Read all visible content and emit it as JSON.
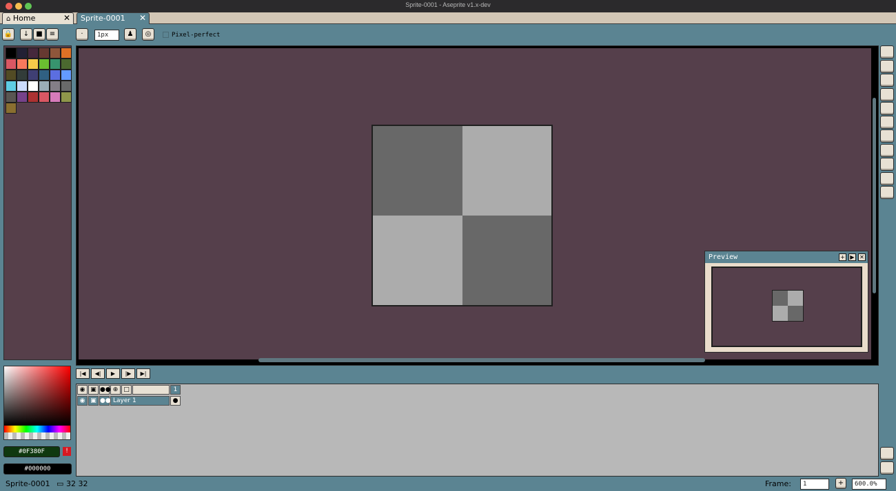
{
  "window": {
    "title": "Sprite-0001 - Aseprite v1.x-dev"
  },
  "tabs": [
    {
      "label": "Home",
      "close": "✕"
    },
    {
      "label": "Sprite-0001",
      "close": "✕"
    }
  ],
  "toolbar": {
    "brush_size": "1px",
    "pixel_perfect_label": "Pixel-perfect"
  },
  "colors": {
    "window_bg": "#5b8492",
    "canvas_bg": "#553f4b",
    "sprite_dark": "#686868",
    "sprite_light": "#acacac"
  },
  "palette": [
    "#000000",
    "#222034",
    "#45283c",
    "#663931",
    "#8f563b",
    "#df7126",
    "#d95763",
    "#f8795d",
    "#f6cc4a",
    "#6abe30",
    "#37946e",
    "#4b692f",
    "#524b24",
    "#323c39",
    "#3f3f74",
    "#306082",
    "#5b6ee1",
    "#639bff",
    "#5fcde4",
    "#cbdbfc",
    "#ffffff",
    "#9badb7",
    "#847e87",
    "#696a6a",
    "#595652",
    "#76428a",
    "#ac3232",
    "#d95763",
    "#d77bba",
    "#8f974a",
    "#8a6f30"
  ],
  "colorbar": {
    "foreground": "#0F380F",
    "background": "#000000"
  },
  "preview": {
    "title": "Preview"
  },
  "timeline": {
    "frame_header": "1",
    "layers": [
      {
        "name": "Layer 1"
      }
    ]
  },
  "status": {
    "sprite_name": "Sprite-0001",
    "size": "32 32",
    "frame_label": "Frame:",
    "frame_value": "1",
    "zoom": "600.0%"
  }
}
